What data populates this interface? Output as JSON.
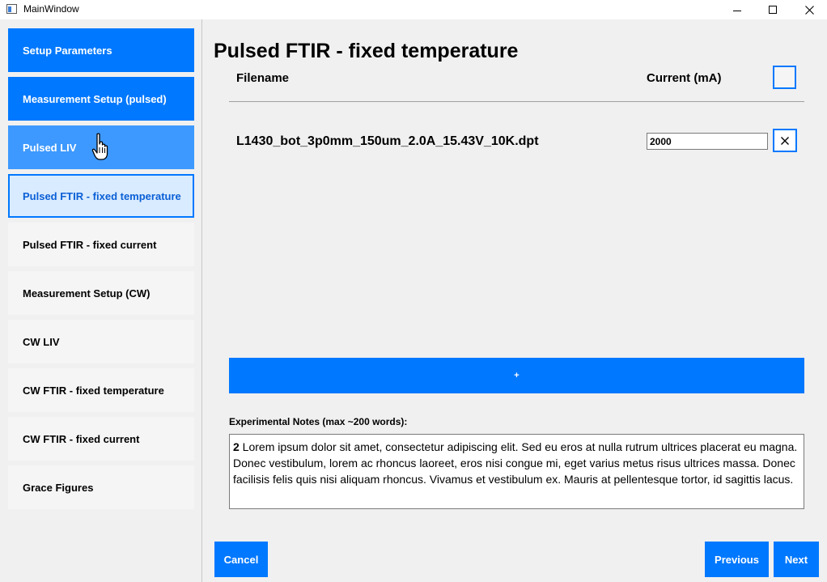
{
  "window": {
    "title": "MainWindow"
  },
  "sidebar": {
    "items": [
      {
        "label": "Setup Parameters"
      },
      {
        "label": "Measurement Setup (pulsed)"
      },
      {
        "label": "Pulsed LIV"
      },
      {
        "label": "Pulsed FTIR - fixed temperature"
      },
      {
        "label": "Pulsed FTIR - fixed current"
      },
      {
        "label": "Measurement Setup (CW)"
      },
      {
        "label": "CW LIV"
      },
      {
        "label": "CW FTIR - fixed temperature"
      },
      {
        "label": "CW FTIR - fixed current"
      },
      {
        "label": "Grace Figures"
      }
    ]
  },
  "main": {
    "title": "Pulsed FTIR - fixed temperature",
    "columns": {
      "filename": "Filename",
      "current": "Current (mA)"
    },
    "rows": [
      {
        "filename": "L1430_bot_3p0mm_150um_2.0A_15.43V_10K.dpt",
        "current": "2000"
      }
    ],
    "add_label": "+",
    "notes_label": "Experimental Notes (max ~200 words):",
    "notes_count": "2",
    "notes_text": " Lorem ipsum dolor sit amet, consectetur adipiscing elit. Sed eu eros at nulla rutrum ultrices placerat eu magna. Donec vestibulum, lorem ac rhoncus laoreet, eros nisi congue mi, eget varius metus risus ultrices massa. Donec facilisis felis quis nisi aliquam rhoncus. Vivamus et vestibulum ex. Mauris at pellentesque tortor, id sagittis lacus."
  },
  "footer": {
    "cancel": "Cancel",
    "previous": "Previous",
    "next": "Next"
  },
  "colors": {
    "accent": "#0078ff",
    "hover": "#3d99ff",
    "active_bg": "#d9ebff"
  }
}
